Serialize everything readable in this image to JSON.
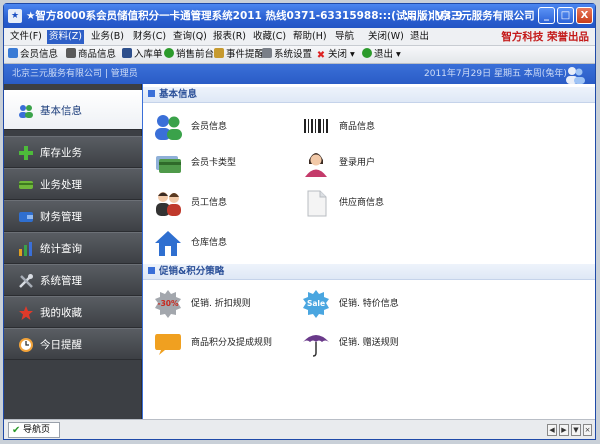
{
  "window": {
    "title": "★智方8000系会员储值积分一卡通管理系统2011  热线0371-63315988:::(试用版) V3.9",
    "title_right": ":::  ☆北京三元服务有限公司",
    "btn_min": "_",
    "btn_max": "□",
    "btn_close": "X"
  },
  "menu": {
    "items": [
      "文件(F)",
      "资料(Z)",
      "业务(B)",
      "财务(C)",
      "查询(Q)",
      "报表(R)",
      "收藏(C)",
      "帮助(H)",
      "导航",
      "关闭(W)",
      "退出"
    ],
    "brand": "智方科技  荣誉出品"
  },
  "toolbar": {
    "items": [
      "会员信息",
      "商品信息",
      "入库单",
      "销售前台",
      "事件提醒",
      "系统设置",
      "关闭",
      "退出"
    ]
  },
  "infobar": {
    "company": "北京三元服务有限公司 | 管理员",
    "date": "2011年7月29日    星期五    本周(兔年)"
  },
  "sidebar": {
    "items": [
      {
        "label": "基本信息",
        "icon": "users-icon",
        "active": true
      },
      {
        "label": "库存业务",
        "icon": "plus-icon",
        "active": false
      },
      {
        "label": "业务处理",
        "icon": "card-icon",
        "active": false
      },
      {
        "label": "财务管理",
        "icon": "wallet-icon",
        "active": false
      },
      {
        "label": "统计查询",
        "icon": "bar-chart-icon",
        "active": false
      },
      {
        "label": "系统管理",
        "icon": "tools-icon",
        "active": false
      },
      {
        "label": "我的收藏",
        "icon": "star-icon",
        "active": false
      },
      {
        "label": "今日提醒",
        "icon": "clock-icon",
        "active": false
      }
    ]
  },
  "content": {
    "section1": "基本信息",
    "section1_modules": [
      {
        "label": "会员信息",
        "icon": "members-icon"
      },
      {
        "label": "商品信息",
        "icon": "barcode-icon"
      },
      {
        "label": "会员卡类型",
        "icon": "member-card-icon"
      },
      {
        "label": "登录用户",
        "icon": "login-user-icon"
      },
      {
        "label": "员工信息",
        "icon": "staff-icon"
      },
      {
        "label": "供应商信息",
        "icon": "document-icon"
      },
      {
        "label": "仓库信息",
        "icon": "warehouse-icon"
      }
    ],
    "section2": "促销&积分策略",
    "section2_modules": [
      {
        "label": "促销. 折扣规则",
        "icon": "discount-icon"
      },
      {
        "label": "促销. 特价信息",
        "icon": "sale-icon"
      },
      {
        "label": "商品积分及提成规则",
        "icon": "points-icon"
      },
      {
        "label": "促销. 赠送规则",
        "icon": "gift-umbrella-icon"
      }
    ],
    "discount_badge": "-30%",
    "sale_badge": "Sale"
  },
  "bottombar": {
    "tab": "导航页"
  },
  "colors": {
    "title_blue": "#2a5fd0",
    "sidebar_dark": "#3c3f44",
    "brand_red": "#c41a1a"
  }
}
